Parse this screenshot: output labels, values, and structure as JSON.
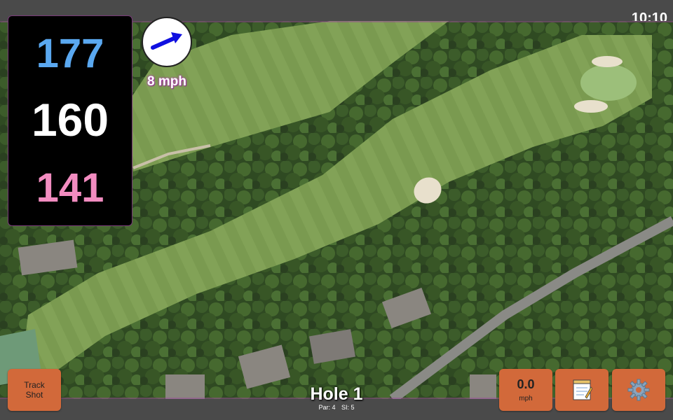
{
  "status": {
    "time": "10:10"
  },
  "yardages": {
    "back": "177",
    "middle": "160",
    "front": "141",
    "back_color": "#5aa8f0",
    "middle_color": "#ffffff",
    "front_color": "#f28cc0"
  },
  "wind": {
    "speed": "8 mph",
    "arrow_color": "#1010e0"
  },
  "track_button": {
    "label_line1": "Track",
    "label_line2": "Shot"
  },
  "hole": {
    "title": "Hole 1",
    "par": "Par: 4",
    "si": "SI: 5"
  },
  "speed_button": {
    "value": "0.0",
    "unit": "mph"
  },
  "icons": {
    "notes": "notepad-icon",
    "settings": "gear-icon"
  },
  "colors": {
    "button": "#d2693a",
    "background": "#4a4a4a"
  }
}
